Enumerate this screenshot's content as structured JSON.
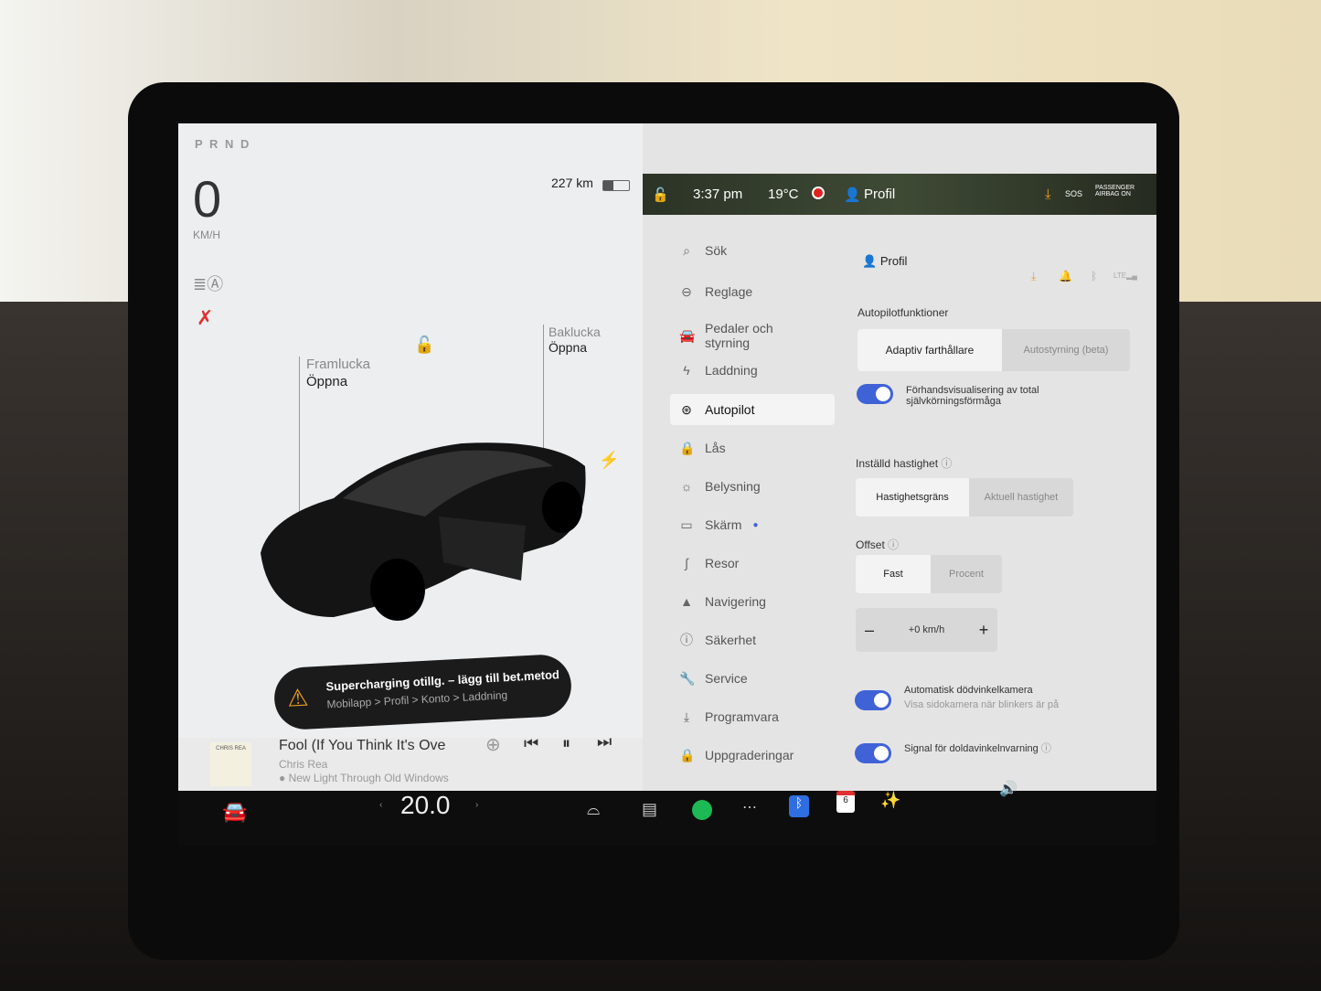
{
  "status": {
    "gear": "P R N D",
    "speed": "0",
    "speed_unit": "KM/H",
    "range": "227 km",
    "time": "3:37 pm",
    "temperature": "19°C",
    "profile": "Profil",
    "passenger_airbag": "PASSENGER AIRBAG ON",
    "sos": "SOS"
  },
  "car": {
    "frunk_label": "Framlucka",
    "frunk_action": "Öppna",
    "trunk_label": "Baklucka",
    "trunk_action": "Öppna"
  },
  "alert": {
    "title": "Supercharging otillg. – lägg till bet.metod",
    "subtitle": "Mobilapp > Profil > Konto > Laddning"
  },
  "media": {
    "album_art_text": "CHRIS REA",
    "title": "Fool (If You Think It's Ove",
    "artist": "Chris Rea",
    "album": "New Light Through Old Windows"
  },
  "menu": {
    "items": [
      {
        "label": "Sök",
        "icon": "search"
      },
      {
        "label": "Reglage",
        "icon": "toggle"
      },
      {
        "label": "Pedaler och styrning",
        "icon": "car"
      },
      {
        "label": "Laddning",
        "icon": "bolt"
      },
      {
        "label": "Autopilot",
        "icon": "steering-wheel",
        "active": true
      },
      {
        "label": "Lås",
        "icon": "lock"
      },
      {
        "label": "Belysning",
        "icon": "sun"
      },
      {
        "label": "Skärm",
        "icon": "display"
      },
      {
        "label": "Resor",
        "icon": "trips"
      },
      {
        "label": "Navigering",
        "icon": "navigation"
      },
      {
        "label": "Säkerhet",
        "icon": "alert"
      },
      {
        "label": "Service",
        "icon": "wrench"
      },
      {
        "label": "Programvara",
        "icon": "download"
      },
      {
        "label": "Uppgraderingar",
        "icon": "bag"
      }
    ]
  },
  "settings": {
    "profile": "Profil",
    "autopilot_features": {
      "label": "Autopilotfunktioner",
      "options": [
        "Adaptiv farthållare",
        "Autostyrning (beta)"
      ],
      "selected": 0
    },
    "fsd_preview": {
      "label": "Förhandsvisualisering av total självkörningsförmåga",
      "enabled": true
    },
    "set_speed": {
      "label": "Inställd hastighet",
      "options": [
        "Hastighetsgräns",
        "Aktuell hastighet"
      ],
      "selected": 0
    },
    "offset": {
      "label": "Offset",
      "options": [
        "Fast",
        "Procent"
      ],
      "selected": 0,
      "value": "+0 km/h",
      "minus": "–",
      "plus": "+"
    },
    "blind_spot_camera": {
      "label": "Automatisk dödvinkelkamera",
      "sublabel": "Visa sidokamera när blinkers är på",
      "enabled": true
    },
    "blind_spot_chime": {
      "label": "Signal för doldavinkelnvarning",
      "enabled": true
    }
  },
  "taskbar": {
    "temperature": "20.0",
    "calendar_day": "6"
  },
  "colors": {
    "accent": "#3f63d6",
    "warning": "#f0a020",
    "record": "#e02020"
  }
}
